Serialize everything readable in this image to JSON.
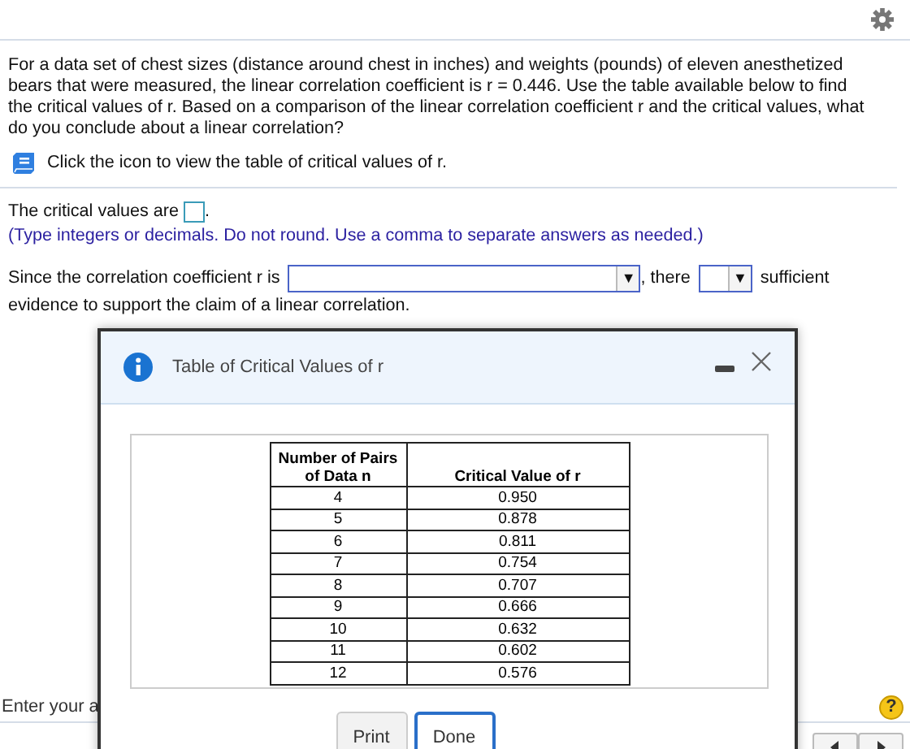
{
  "question": {
    "paragraph": "For a data set of chest sizes (distance around chest in inches) and weights (pounds) of eleven anesthetized bears that were measured, the linear correlation coefficient is r = 0.446. Use the table available below to find the critical values of r. Based on a comparison of the linear correlation coefficient r and the critical values, what do you conclude about a linear correlation?",
    "table_link": "Click the icon to view the table of critical values of r."
  },
  "answer": {
    "critical_label": "The critical values are",
    "critical_end": ".",
    "hint": "(Type integers or decimals. Do not round. Use a comma to separate answers as needed.)",
    "since_label": "Since the correlation coefficient r is",
    "dropdown_arrow": "▼",
    "there_label": ", there",
    "sufficient_label": "sufficient",
    "evidence_text": "evidence to support the claim of a linear correlation."
  },
  "footer": {
    "prompt": "Enter your a",
    "help": "?"
  },
  "dialog": {
    "title": "Table of Critical Values of r",
    "columns": [
      "Number of Pairs of Data n",
      "Critical Value of r"
    ],
    "rows": [
      [
        "4",
        "0.950"
      ],
      [
        "5",
        "0.878"
      ],
      [
        "6",
        "0.811"
      ],
      [
        "7",
        "0.754"
      ],
      [
        "8",
        "0.707"
      ],
      [
        "9",
        "0.666"
      ],
      [
        "10",
        "0.632"
      ],
      [
        "11",
        "0.602"
      ],
      [
        "12",
        "0.576"
      ]
    ],
    "buttons": [
      {
        "label": "Print",
        "kind": "plain"
      },
      {
        "label": "Done",
        "kind": "focused"
      }
    ]
  }
}
